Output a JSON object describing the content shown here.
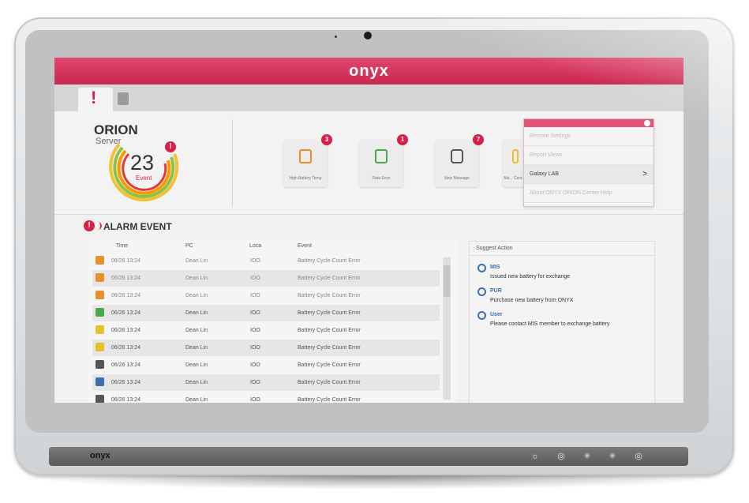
{
  "device": {
    "brand": "onyx"
  },
  "app": {
    "brand": "onyx"
  },
  "summary": {
    "title": "ORION",
    "subtitle": "Server",
    "count": "23",
    "count_label": "Event"
  },
  "tiles": [
    {
      "label": "High Battery Temp",
      "badge": "3",
      "color": "#e8902a"
    },
    {
      "label": "Data Error",
      "badge": "1",
      "color": "#4aa84a"
    },
    {
      "label": "New Message",
      "badge": "7",
      "color": "#555555"
    },
    {
      "label": "Ma... Cent...",
      "badge": "",
      "color": "#e8c02a"
    }
  ],
  "menu": {
    "items": [
      {
        "label": "Remote Settings"
      },
      {
        "label": "Report Views"
      },
      {
        "label": "Galaxy LAB",
        "chevron": ">"
      },
      {
        "label": "About ONYX ORION Center Help"
      }
    ]
  },
  "alarm": {
    "title": "ALARM EVENT",
    "columns": [
      "Time",
      "PC",
      "Loca",
      "Event"
    ],
    "rows": [
      {
        "time": "06/26 13:24",
        "pc": "Dean Lin",
        "loc": "IOO",
        "event": "Battery Cycle Count Error",
        "icon": "battery-icon",
        "color": "#e8902a"
      },
      {
        "time": "06/26 13:24",
        "pc": "Dean Lin",
        "loc": "IOO",
        "event": "Battery Cycle Count Error",
        "icon": "battery-icon",
        "color": "#e8902a"
      },
      {
        "time": "06/26 13:24",
        "pc": "Dean Lin",
        "loc": "IOO",
        "event": "Battery Cycle Count Error",
        "icon": "battery-icon",
        "color": "#e8902a"
      },
      {
        "time": "06/26 13:24",
        "pc": "Dean Lin",
        "loc": "IOO",
        "event": "Battery Cycle Count Error",
        "icon": "data-error-icon",
        "color": "#4aa84a"
      },
      {
        "time": "06/26 13:24",
        "pc": "Dean Lin",
        "loc": "IOO",
        "event": "Battery Cycle Count Error",
        "icon": "wifi-icon",
        "color": "#e8c02a"
      },
      {
        "time": "06/26 13:24",
        "pc": "Dean Lin",
        "loc": "IOO",
        "event": "Battery Cycle Count Error",
        "icon": "wifi-icon",
        "color": "#e8c02a"
      },
      {
        "time": "06/26 13:24",
        "pc": "Dean Lin",
        "loc": "IOO",
        "event": "Battery Cycle Count Error",
        "icon": "message-icon",
        "color": "#555555"
      },
      {
        "time": "06/26 13:24",
        "pc": "Dean Lin",
        "loc": "IOO",
        "event": "Battery Cycle Count Error",
        "icon": "device-icon",
        "color": "#3a6fb0"
      },
      {
        "time": "06/26 13:24",
        "pc": "Dean Lin",
        "loc": "IOO",
        "event": "Battery Cycle Count Error",
        "icon": "message-icon",
        "color": "#555555"
      }
    ]
  },
  "suggest": {
    "title": "Suggest Action",
    "items": [
      {
        "title": "MIS",
        "text": "Issued new battery for exchange"
      },
      {
        "title": "PUR",
        "text": "Purchase new battery from ONYX"
      },
      {
        "title": "User",
        "text": "Please contact MIS member to exchange battery"
      }
    ]
  },
  "colors": {
    "accent": "#d6204a",
    "topbar": "#d6365e",
    "link": "#3a6fb0"
  }
}
